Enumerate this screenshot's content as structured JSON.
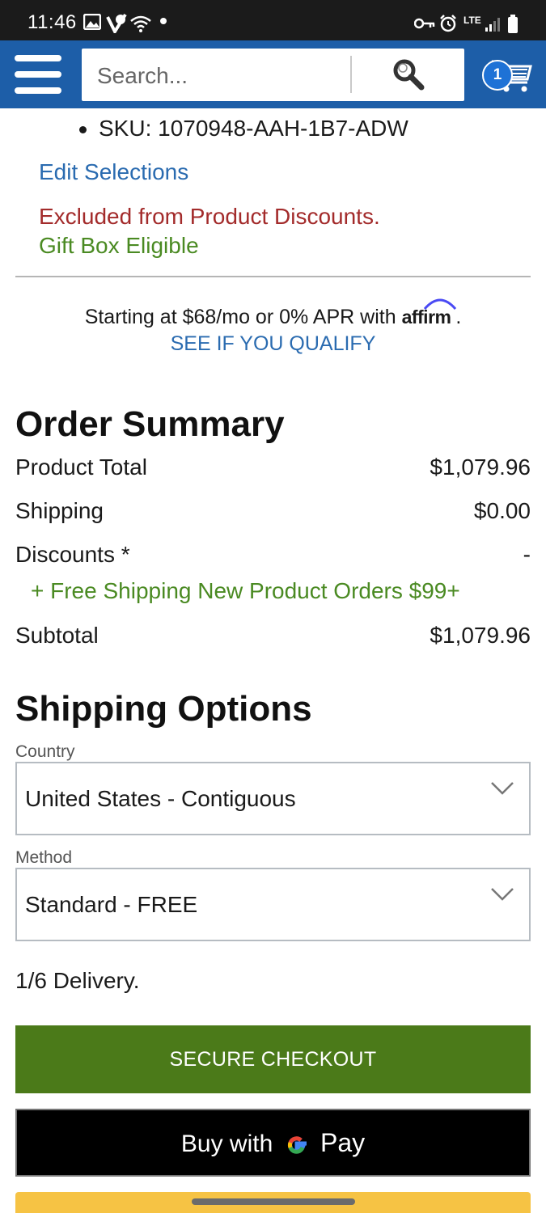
{
  "status_bar": {
    "time": "11:46",
    "network": "LTE"
  },
  "header": {
    "search_placeholder": "Search...",
    "cart_count": "1"
  },
  "product": {
    "sku": "SKU: 1070948-AAH-1B7-ADW",
    "edit_link": "Edit Selections",
    "excluded_notice": "Excluded from Product Discounts.",
    "gift_box": "Gift Box Eligible"
  },
  "affirm": {
    "text_prefix": "Starting at $68/mo or 0% APR with",
    "logo": "affirm",
    "text_suffix": ".",
    "qualify_link": "SEE IF YOU QUALIFY"
  },
  "order_summary": {
    "title": "Order Summary",
    "rows": [
      {
        "label": "Product Total",
        "value": "$1,079.96"
      },
      {
        "label": "Shipping",
        "value": "$0.00"
      },
      {
        "label": "Discounts *",
        "value": "-"
      }
    ],
    "promo": "+ Free Shipping New Product Orders $99+",
    "subtotal_label": "Subtotal",
    "subtotal_value": "$1,079.96"
  },
  "shipping": {
    "title": "Shipping Options",
    "country_label": "Country",
    "country_value": "United States - Contiguous",
    "method_label": "Method",
    "method_value": "Standard - FREE",
    "delivery_note": "1/6 Delivery."
  },
  "actions": {
    "checkout_label": "SECURE CHECKOUT",
    "gpay_prefix": "Buy with",
    "gpay_suffix": "Pay"
  },
  "colors": {
    "header_blue": "#1d5ea8",
    "link_blue": "#2a6bb0",
    "alert_red": "#a32b2b",
    "success_green": "#4a8a22",
    "checkout_green": "#4b7a19"
  }
}
